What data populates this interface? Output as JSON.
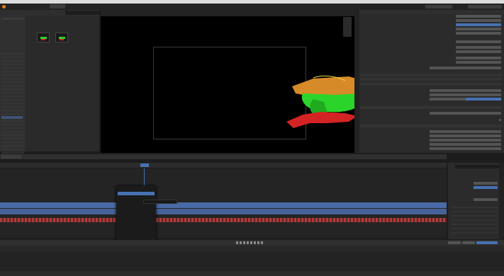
{
  "titlebar": {
    "title": ""
  },
  "menubar": {
    "items": [
      "",
      "",
      "",
      "",
      ""
    ],
    "workspace_tabs": [
      "",
      ""
    ]
  },
  "file_browser": {
    "files": [
      "",
      ""
    ],
    "sidebar_items": [
      "",
      "",
      "",
      "",
      "",
      "",
      "",
      "",
      "",
      "",
      "",
      "",
      "",
      "",
      "",
      "",
      "",
      "",
      "",
      ""
    ]
  },
  "viewport": {
    "header": [
      "",
      ""
    ]
  },
  "properties": {
    "rows": [
      "",
      "",
      "",
      "",
      "",
      "",
      "",
      "",
      "",
      "",
      "",
      "",
      "",
      "",
      "",
      ""
    ]
  },
  "sequencer": {
    "header_items": [
      "",
      "",
      "",
      "",
      "",
      "",
      ""
    ],
    "current_frame": ""
  },
  "context_menu": {
    "title": "",
    "tooltip": "",
    "items": [
      "",
      "",
      "",
      "",
      "",
      "",
      "",
      "",
      "",
      "",
      "",
      "",
      "",
      "",
      "",
      "",
      "",
      "",
      "",
      "",
      "",
      ""
    ]
  },
  "strip_panel": {
    "header": "",
    "sections": [
      "",
      "",
      "",
      "",
      "",
      "",
      ""
    ]
  },
  "statusbar": {
    "items": [
      "",
      "",
      "",
      ""
    ]
  },
  "colors": {
    "ui_dark": "#1d1d1d",
    "panel": "#282828",
    "accent_blue": "#4772b3",
    "strip_blue": "#4a6aa6",
    "strip_red": "#b4393a",
    "mesh_green": "#2bd42b",
    "mesh_orange": "#d78a28",
    "mesh_red": "#d42323"
  }
}
